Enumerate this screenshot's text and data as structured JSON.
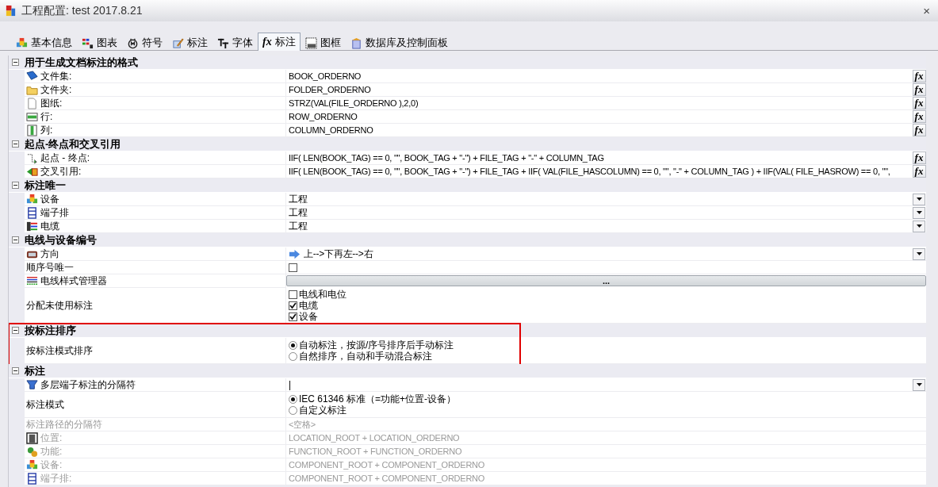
{
  "window": {
    "title": "工程配置: test 2017.8.21",
    "close": "×"
  },
  "tabs": [
    {
      "label": "基本信息",
      "selected": false
    },
    {
      "label": "图表",
      "selected": false
    },
    {
      "label": "符号",
      "selected": false
    },
    {
      "label": "标注",
      "selected": false
    },
    {
      "label": "字体",
      "selected": false
    },
    {
      "label": "标注",
      "icon_text": "fx",
      "selected": true
    },
    {
      "label": "图框",
      "selected": false
    },
    {
      "label": "数据库及控制面板",
      "selected": false
    }
  ],
  "sections": [
    {
      "title": "用于生成文档标注的格式",
      "expanded": true,
      "highlighted": false,
      "rows": [
        {
          "label": "文件集:",
          "kind": "text",
          "value": "BOOK_ORDERNO",
          "button": "fx",
          "disabled": false
        },
        {
          "label": "文件夹:",
          "kind": "text",
          "value": "FOLDER_ORDERNO",
          "button": "fx",
          "disabled": false
        },
        {
          "label": "图纸:",
          "kind": "text",
          "value": "STRZ(VAL(FILE_ORDERNO ),2,0)",
          "button": "fx",
          "disabled": false
        },
        {
          "label": "行:",
          "kind": "text",
          "value": "ROW_ORDERNO",
          "button": "fx",
          "disabled": false
        },
        {
          "label": "列:",
          "kind": "text",
          "value": "COLUMN_ORDERNO",
          "button": "fx",
          "disabled": false
        }
      ]
    },
    {
      "title": "起点-终点和交叉引用",
      "expanded": true,
      "highlighted": false,
      "rows": [
        {
          "label": "起点 - 终点:",
          "kind": "text",
          "value": " IIF( LEN(BOOK_TAG) == 0, \"\", BOOK_TAG + \"-\") + FILE_TAG + \"-\" + COLUMN_TAG",
          "button": "fx",
          "disabled": false
        },
        {
          "label": "交叉引用:",
          "kind": "text",
          "value": "IIF( LEN(BOOK_TAG) == 0, \"\", BOOK_TAG + \"-\") + FILE_TAG + IIF( VAL(FILE_HASCOLUMN) == 0, \"\", \"-\" + COLUMN_TAG ) + IIF(VAL( FILE_HASROW) == 0, \"\",",
          "button": "fx",
          "disabled": false
        }
      ]
    },
    {
      "title": "标注唯一",
      "expanded": true,
      "highlighted": false,
      "rows": [
        {
          "label": "设备",
          "kind": "dropdown",
          "value": "工程",
          "disabled": false
        },
        {
          "label": "端子排",
          "kind": "dropdown",
          "value": "工程",
          "disabled": false
        },
        {
          "label": "电缆",
          "kind": "dropdown",
          "value": "工程",
          "disabled": false
        }
      ]
    },
    {
      "title": "电线与设备编号",
      "expanded": true,
      "highlighted": false,
      "rows": [
        {
          "label": "方向",
          "kind": "direction",
          "value": "上-->下再左-->右",
          "disabled": false
        },
        {
          "label": "顺序号唯一",
          "kind": "checkbox",
          "checked": false,
          "disabled": false
        },
        {
          "label": "电线样式管理器",
          "kind": "ellipsis",
          "value": "...",
          "disabled": false
        },
        {
          "label": "分配未使用标注",
          "kind": "checklist",
          "disabled": false,
          "options": [
            {
              "label": "电线和电位",
              "checked": false
            },
            {
              "label": "电缆",
              "checked": true
            },
            {
              "label": "设备",
              "checked": true
            }
          ]
        }
      ]
    },
    {
      "title": "按标注排序",
      "expanded": true,
      "highlighted": true,
      "rows": [
        {
          "label": "按标注模式排序",
          "kind": "radio",
          "disabled": false,
          "options": [
            {
              "label": "自动标注，按源/序号排序后手动标注",
              "selected": true
            },
            {
              "label": "自然排序，自动和手动混合标注",
              "selected": false
            }
          ]
        }
      ]
    },
    {
      "title": "标注",
      "expanded": true,
      "highlighted": false,
      "rows": [
        {
          "label": "多层端子标注的分隔符",
          "kind": "dropdown",
          "value": "|",
          "disabled": false
        },
        {
          "label": "标注模式",
          "kind": "radio",
          "disabled": false,
          "options": [
            {
              "label": "IEC 61346 标准（=功能+位置-设备）",
              "selected": true
            },
            {
              "label": "自定义标注",
              "selected": false
            }
          ]
        },
        {
          "label": "标注路径的分隔符",
          "kind": "text",
          "value": "<空格>",
          "disabled": true
        },
        {
          "label": "位置:",
          "kind": "text",
          "value": "LOCATION_ROOT + LOCATION_ORDERNO",
          "disabled": true
        },
        {
          "label": "功能:",
          "kind": "text",
          "value": "FUNCTION_ROOT + FUNCTION_ORDERNO",
          "disabled": true
        },
        {
          "label": "设备:",
          "kind": "text",
          "value": "COMPONENT_ROOT + COMPONENT_ORDERNO",
          "disabled": true
        },
        {
          "label": "端子排:",
          "kind": "text",
          "value": "COMPONENT_ROOT + COMPONENT_ORDERNO",
          "disabled": true
        }
      ]
    }
  ]
}
